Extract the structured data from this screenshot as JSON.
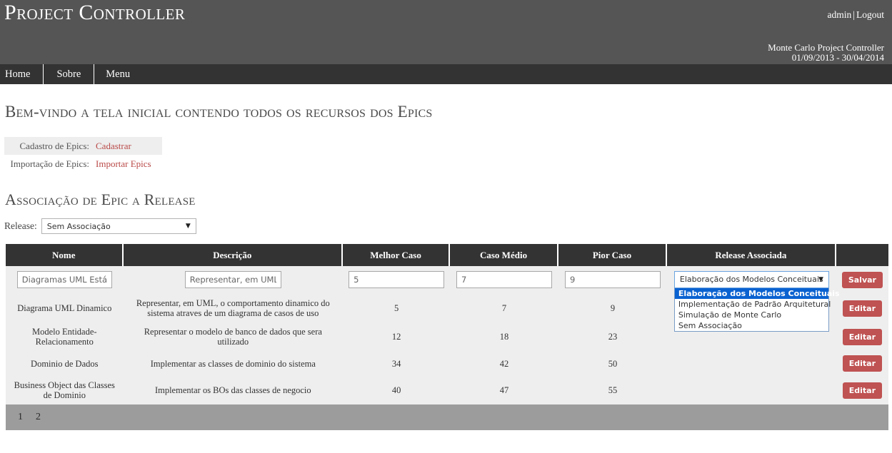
{
  "header": {
    "brand": "Project Controller",
    "user": "admin",
    "separator": "|",
    "logout": "Logout",
    "project_name": "Monte Carlo Project Controller",
    "project_period": "01/09/2013 - 30/04/2014",
    "bg_color": "#555555"
  },
  "nav": {
    "bg_color": "#333333",
    "items": [
      {
        "label": "Home"
      },
      {
        "label": "Sobre"
      },
      {
        "label": "Menu"
      }
    ]
  },
  "main": {
    "page_heading": "Bem-vindo a tela inicial contendo todos os recursos dos Epics",
    "sub_heading": "Associação de Epic a Release",
    "epic_actions": [
      {
        "label": "Cadastro de Epics:",
        "link": "Cadastrar"
      },
      {
        "label": "Importação de Epics:",
        "link": "Importar Epics"
      }
    ],
    "link_color": "#b94a48",
    "release_filter": {
      "label": "Release:",
      "value": "Sem Associação",
      "caret": "▼"
    }
  },
  "table": {
    "columns": [
      "Nome",
      "Descrição",
      "Melhor Caso",
      "Caso Médio",
      "Pior Caso",
      "Release Associada",
      ""
    ],
    "edit_row": {
      "nome": "Diagramas UML Estático",
      "descricao": "Representar, em UML, o c",
      "melhor_caso": "5",
      "caso_medio": "7",
      "pior_caso": "9",
      "release_selected": "Elaboração dos Modelos Conceituais",
      "release_options": [
        "Elaboração dos Modelos Conceituais",
        "Implementação de Padrão Arquitetural",
        "Simulação de Monte Carlo",
        "Sem Associação"
      ],
      "caret": "▼",
      "save_label": "Salvar"
    },
    "rows": [
      {
        "nome": "Diagrama UML Dinamico",
        "descricao": "Representar, em UML, o comportamento dinamico do sistema atraves de um diagrama de casos de uso",
        "melhor_caso": "5",
        "caso_medio": "7",
        "pior_caso": "9",
        "release": "",
        "action": "Editar"
      },
      {
        "nome": "Modelo Entidade-Relacionamento",
        "descricao": "Representar o modelo de banco de dados que sera utilizado",
        "melhor_caso": "12",
        "caso_medio": "18",
        "pior_caso": "23",
        "release": "",
        "action": "Editar"
      },
      {
        "nome": "Dominio de Dados",
        "descricao": "Implementar as classes de dominio do sistema",
        "melhor_caso": "34",
        "caso_medio": "42",
        "pior_caso": "50",
        "release": "",
        "action": "Editar"
      },
      {
        "nome": "Business Object das Classes de Dominio",
        "descricao": "Implementar os BOs das classes de negocio",
        "melhor_caso": "40",
        "caso_medio": "47",
        "pior_caso": "55",
        "release": "",
        "action": "Editar"
      }
    ],
    "button_color": "#bf5252",
    "header_bg": "#333333",
    "row_bg": "#eeeeee"
  },
  "pagination": {
    "pages": [
      "1",
      "2"
    ],
    "bg_color": "#9c9c9c"
  }
}
